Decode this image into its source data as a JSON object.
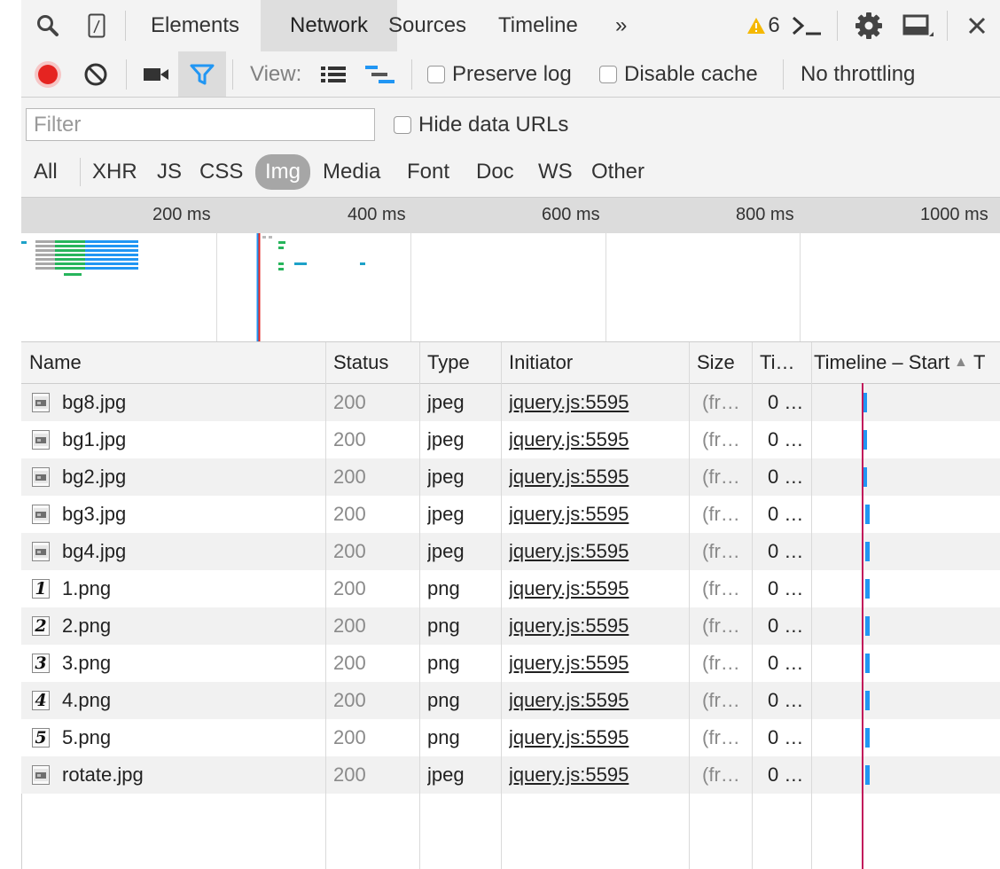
{
  "tabs": [
    {
      "label": "Elements",
      "active": false
    },
    {
      "label": "Network",
      "active": true
    },
    {
      "label": "Sources",
      "active": false
    },
    {
      "label": "Timeline",
      "active": false
    }
  ],
  "more_label": "»",
  "warning_count": "6",
  "toolbar": {
    "view_label": "View:",
    "preserve_log_label": "Preserve log",
    "disable_cache_label": "Disable cache",
    "throttling_value": "No throttling"
  },
  "filter": {
    "placeholder": "Filter",
    "hide_data_urls_label": "Hide data URLs",
    "types": [
      {
        "label": "All",
        "active": false
      },
      {
        "label": "XHR",
        "active": false
      },
      {
        "label": "JS",
        "active": false
      },
      {
        "label": "CSS",
        "active": false
      },
      {
        "label": "Img",
        "active": true
      },
      {
        "label": "Media",
        "active": false
      },
      {
        "label": "Font",
        "active": false
      },
      {
        "label": "Doc",
        "active": false
      },
      {
        "label": "WS",
        "active": false
      },
      {
        "label": "Other",
        "active": false
      }
    ]
  },
  "overview": {
    "ticks": [
      "200 ms",
      "400 ms",
      "600 ms",
      "800 ms",
      "1000 ms"
    ]
  },
  "table": {
    "columns": [
      "Name",
      "Status",
      "Type",
      "Initiator",
      "Size",
      "Ti…",
      "Timeline – Start"
    ],
    "sort_indicator": "▲",
    "rows": [
      {
        "name": "bg8.jpg",
        "status": "200",
        "type": "jpeg",
        "initiator": "jquery.js:5595",
        "size": "(fr…",
        "time": "0 …",
        "icon": "image-thumbnail-icon"
      },
      {
        "name": "bg1.jpg",
        "status": "200",
        "type": "jpeg",
        "initiator": "jquery.js:5595",
        "size": "(fr…",
        "time": "0 …",
        "icon": "image-thumbnail-icon"
      },
      {
        "name": "bg2.jpg",
        "status": "200",
        "type": "jpeg",
        "initiator": "jquery.js:5595",
        "size": "(fr…",
        "time": "0 …",
        "icon": "image-thumbnail-icon"
      },
      {
        "name": "bg3.jpg",
        "status": "200",
        "type": "jpeg",
        "initiator": "jquery.js:5595",
        "size": "(fr…",
        "time": "0 …",
        "icon": "image-thumbnail-icon"
      },
      {
        "name": "bg4.jpg",
        "status": "200",
        "type": "jpeg",
        "initiator": "jquery.js:5595",
        "size": "(fr…",
        "time": "0 …",
        "icon": "image-thumbnail-icon"
      },
      {
        "name": "1.png",
        "status": "200",
        "type": "png",
        "initiator": "jquery.js:5595",
        "size": "(fr…",
        "time": "0 …",
        "icon": "digit-thumbnail-icon",
        "glyph": "1"
      },
      {
        "name": "2.png",
        "status": "200",
        "type": "png",
        "initiator": "jquery.js:5595",
        "size": "(fr…",
        "time": "0 …",
        "icon": "digit-thumbnail-icon",
        "glyph": "2"
      },
      {
        "name": "3.png",
        "status": "200",
        "type": "png",
        "initiator": "jquery.js:5595",
        "size": "(fr…",
        "time": "0 …",
        "icon": "digit-thumbnail-icon",
        "glyph": "3"
      },
      {
        "name": "4.png",
        "status": "200",
        "type": "png",
        "initiator": "jquery.js:5595",
        "size": "(fr…",
        "time": "0 …",
        "icon": "digit-thumbnail-icon",
        "glyph": "4"
      },
      {
        "name": "5.png",
        "status": "200",
        "type": "png",
        "initiator": "jquery.js:5595",
        "size": "(fr…",
        "time": "0 …",
        "icon": "digit-thumbnail-icon",
        "glyph": "5"
      },
      {
        "name": "rotate.jpg",
        "status": "200",
        "type": "jpeg",
        "initiator": "jquery.js:5595",
        "size": "(fr…",
        "time": "0 …",
        "icon": "image-thumbnail-icon"
      }
    ]
  },
  "colors": {
    "accent": "#2196f3",
    "record": "#e52421",
    "warning": "#f5b800",
    "marker": "#c2185b",
    "row_alt": "#f1f1f1"
  }
}
